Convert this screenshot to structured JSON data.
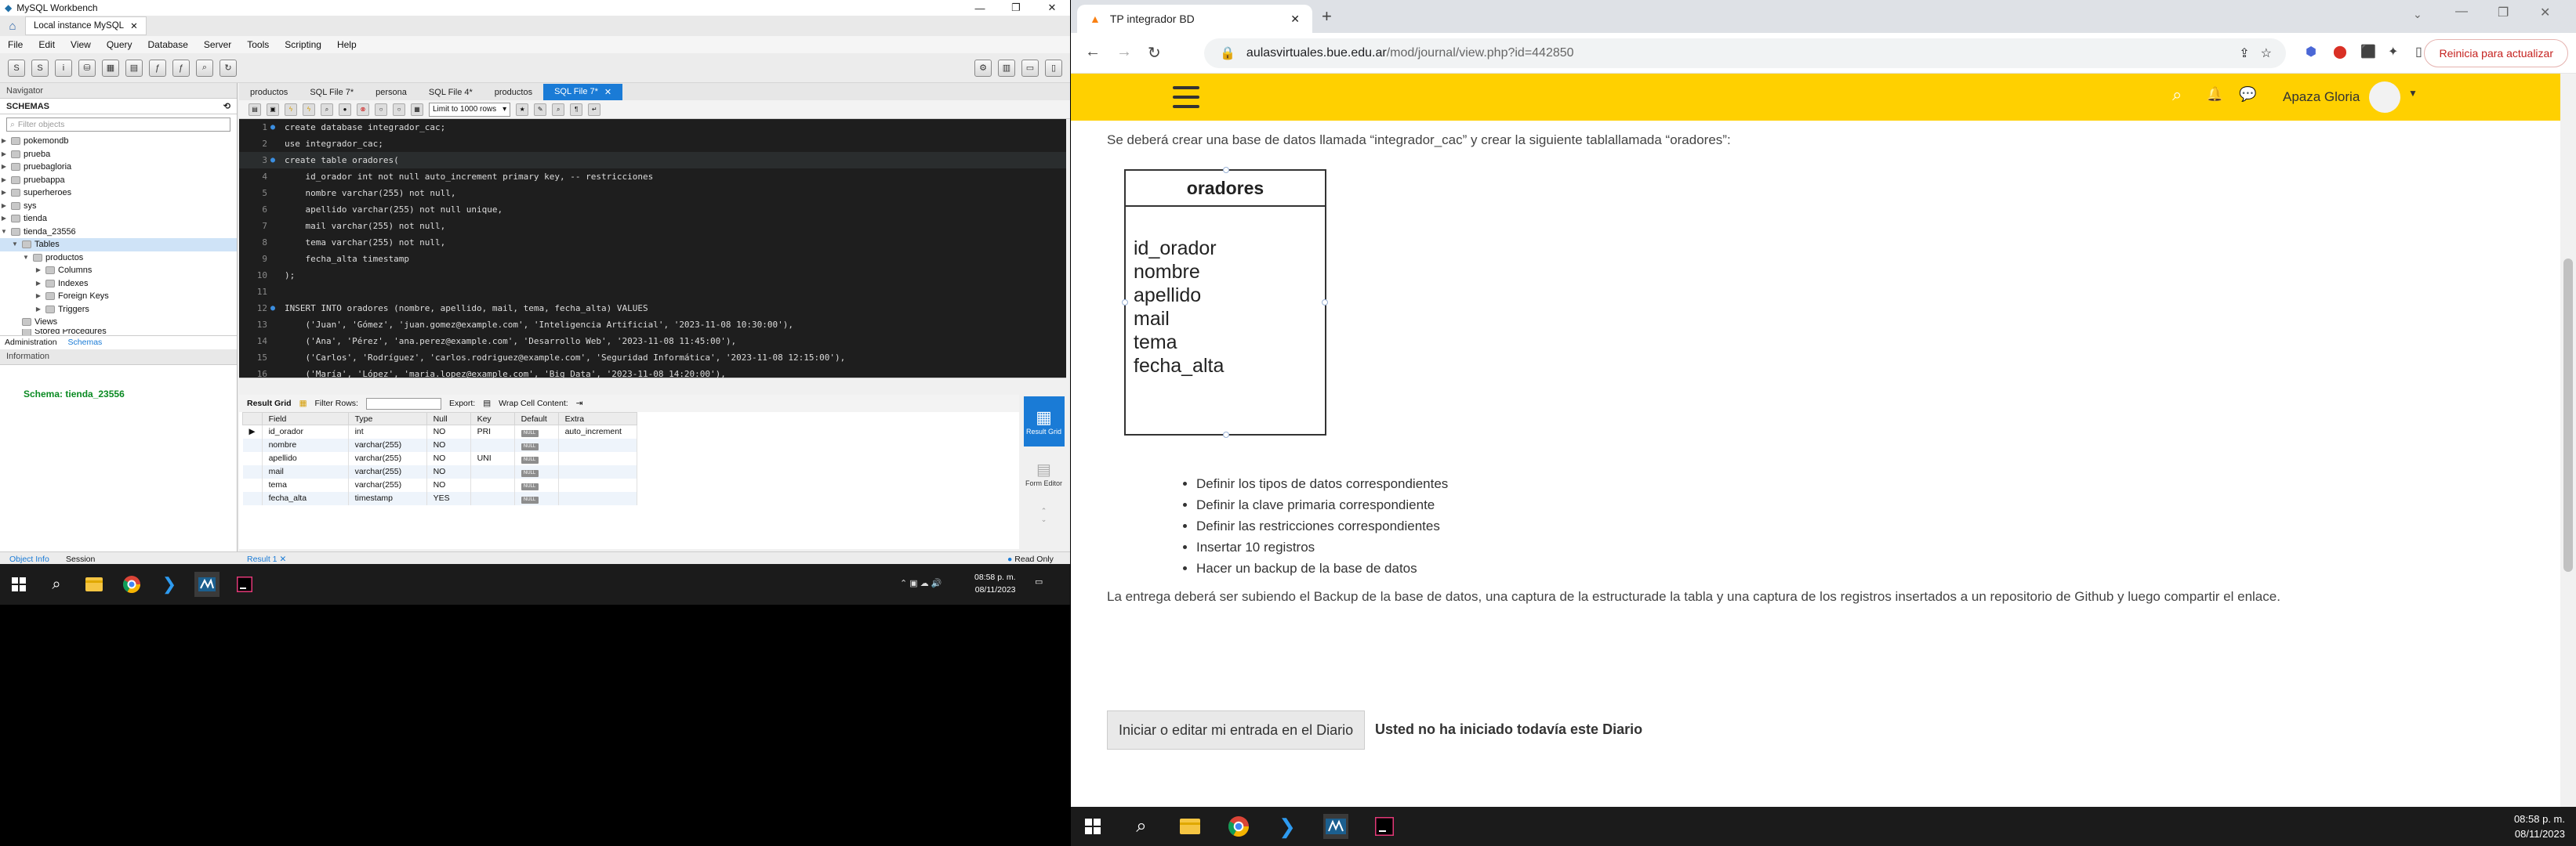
{
  "workbench": {
    "window_title": "MySQL Workbench",
    "instance_tab": "Local instance MySQL",
    "menu": [
      "File",
      "Edit",
      "View",
      "Query",
      "Database",
      "Server",
      "Tools",
      "Scripting",
      "Help"
    ],
    "navigator_label": "Navigator",
    "schemas_label": "SCHEMAS",
    "filter_placeholder": "Filter objects",
    "schemas": [
      "pokemondb",
      "prueba",
      "pruebagloria",
      "pruebappa",
      "superheroes",
      "sys",
      "tienda",
      "tienda_23556"
    ],
    "tree": [
      "Tables",
      "productos",
      "Columns",
      "Indexes",
      "Foreign Keys",
      "Triggers",
      "Views",
      "Stored Procedures"
    ],
    "nav_subtabs": [
      "Administration",
      "Schemas"
    ],
    "information_label": "Information",
    "schema_label": "Schema:",
    "schema_name": "tienda_23556",
    "object_tabs": [
      "Object Info",
      "Session"
    ],
    "editor_tabs": [
      "productos",
      "SQL File 7*",
      "persona",
      "SQL File 4*",
      "productos",
      "SQL File 7*"
    ],
    "limit_label": "Limit to 1000 rows",
    "code_lines": [
      "create database integrador_cac;",
      "use integrador_cac;",
      "create table oradores(",
      "    id_orador int not null auto_increment primary key, -- restricciones",
      "    nombre varchar(255) not null,",
      "    apellido varchar(255) not null unique,",
      "    mail varchar(255) not null,",
      "    tema varchar(255) not null,",
      "    fecha_alta timestamp",
      ");",
      "",
      "INSERT INTO oradores (nombre, apellido, mail, tema, fecha_alta) VALUES",
      "    ('Juan', 'Gómez', 'juan.gomez@example.com', 'Inteligencia Artificial', '2023-11-08 10:30:00'),",
      "    ('Ana', 'Pérez', 'ana.perez@example.com', 'Desarrollo Web', '2023-11-08 11:45:00'),",
      "    ('Carlos', 'Rodríguez', 'carlos.rodriguez@example.com', 'Seguridad Informática', '2023-11-08 12:15:00'),",
      "    ('María', 'López', 'maria.lopez@example.com', 'Big Data', '2023-11-08 14:20:00'),"
    ],
    "result_toolbar": {
      "grid": "Result Grid",
      "filter": "Filter Rows:",
      "export": "Export:",
      "wrap": "Wrap Cell Content:"
    },
    "result_columns": [
      "Field",
      "Type",
      "Null",
      "Key",
      "Default",
      "Extra"
    ],
    "result_rows": [
      [
        "id_orador",
        "int",
        "NO",
        "PRI",
        "NULL",
        "auto_increment"
      ],
      [
        "nombre",
        "varchar(255)",
        "NO",
        "",
        "NULL",
        ""
      ],
      [
        "apellido",
        "varchar(255)",
        "NO",
        "UNI",
        "NULL",
        ""
      ],
      [
        "mail",
        "varchar(255)",
        "NO",
        "",
        "NULL",
        ""
      ],
      [
        "tema",
        "varchar(255)",
        "NO",
        "",
        "NULL",
        ""
      ],
      [
        "fecha_alta",
        "timestamp",
        "YES",
        "",
        "NULL",
        ""
      ]
    ],
    "side_buttons": [
      "Result Grid",
      "Form Editor"
    ],
    "result_tab": "Result 1",
    "read_only": "Read Only",
    "clock_time": "08:58 p. m.",
    "clock_date": "08/11/2023"
  },
  "chrome": {
    "tab_title": "TP integrador BD",
    "url_domain": "aulasvirtuales.bue.edu.ar",
    "url_path": "/mod/journal/view.php?id=442850",
    "update_button": "Reinicia para actualizar",
    "user_name": "Apaza Gloria",
    "intro": "Se deberá crear una base de datos llamada “integrador_cac” y crear la siguiente tablallamada “oradores”:",
    "er_table": "oradores",
    "er_fields": [
      "id_orador",
      "nombre",
      "apellido",
      "mail",
      "tema",
      "fecha_alta"
    ],
    "requirements": [
      "Definir los tipos de datos correspondientes",
      "Definir la clave primaria correspondiente",
      "Definir las restricciones correspondientes",
      "Insertar 10 registros",
      "Hacer un backup de la base de datos"
    ],
    "delivery": "La entrega deberá ser subiendo el Backup de la base de datos, una captura de la estructurade la tabla y una captura de los registros insertados a un repositorio de Github y luego compartir el enlace.",
    "diary_button": "Iniciar o editar mi entrada en el Diario",
    "diary_status": "Usted no ha iniciado todavía este Diario",
    "clock_time": "08:58 p. m.",
    "clock_date": "08/11/2023"
  },
  "colors": {
    "accent": "#1a7bd6",
    "moodle_header": "#ffd000",
    "editor_bg": "#1e1e1e",
    "schema_green": "#0a8a22"
  }
}
